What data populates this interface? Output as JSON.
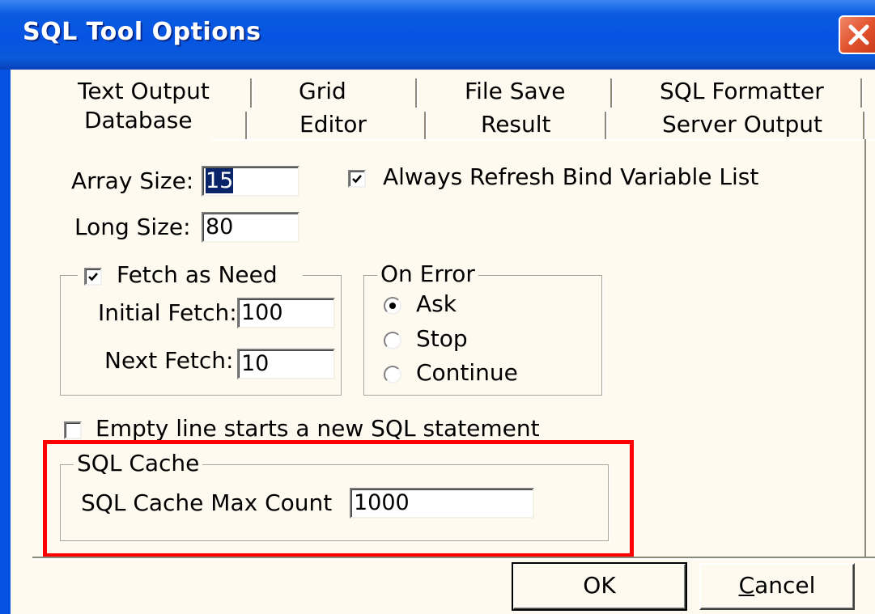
{
  "window": {
    "title": "SQL Tool Options"
  },
  "tabs": {
    "row1": [
      "Text Output",
      "Grid",
      "File Save",
      "SQL Formatter"
    ],
    "row2": [
      "Database",
      "Editor",
      "Result",
      "Server Output"
    ],
    "active": "Database"
  },
  "database": {
    "array_size_label": "Array Size:",
    "array_size_value": "15",
    "long_size_label": "Long Size:",
    "long_size_value": "80",
    "always_refresh_label": "Always Refresh Bind Variable List",
    "always_refresh_checked": true,
    "fetch_group": {
      "caption": "Fetch as Need",
      "checked": true,
      "initial_fetch_label": "Initial Fetch:",
      "initial_fetch_value": "100",
      "next_fetch_label": "Next Fetch:",
      "next_fetch_value": "10"
    },
    "on_error": {
      "caption": "On Error",
      "options": [
        "Ask",
        "Stop",
        "Continue"
      ],
      "selected": "Ask"
    },
    "empty_line_label": "Empty line starts a new SQL statement",
    "empty_line_checked": false,
    "sql_cache": {
      "caption": "SQL Cache",
      "max_count_label": "SQL Cache Max Count",
      "max_count_value": "1000"
    }
  },
  "buttons": {
    "ok": "OK",
    "cancel_prefix": "C",
    "cancel_rest": "ancel"
  },
  "icons": {
    "close": "close-icon",
    "check": "check-icon",
    "radio": "radio-dot-icon"
  },
  "colors": {
    "titlebar": "#0554e3",
    "highlight_box": "#ff0000",
    "selection": "#0a246a"
  }
}
